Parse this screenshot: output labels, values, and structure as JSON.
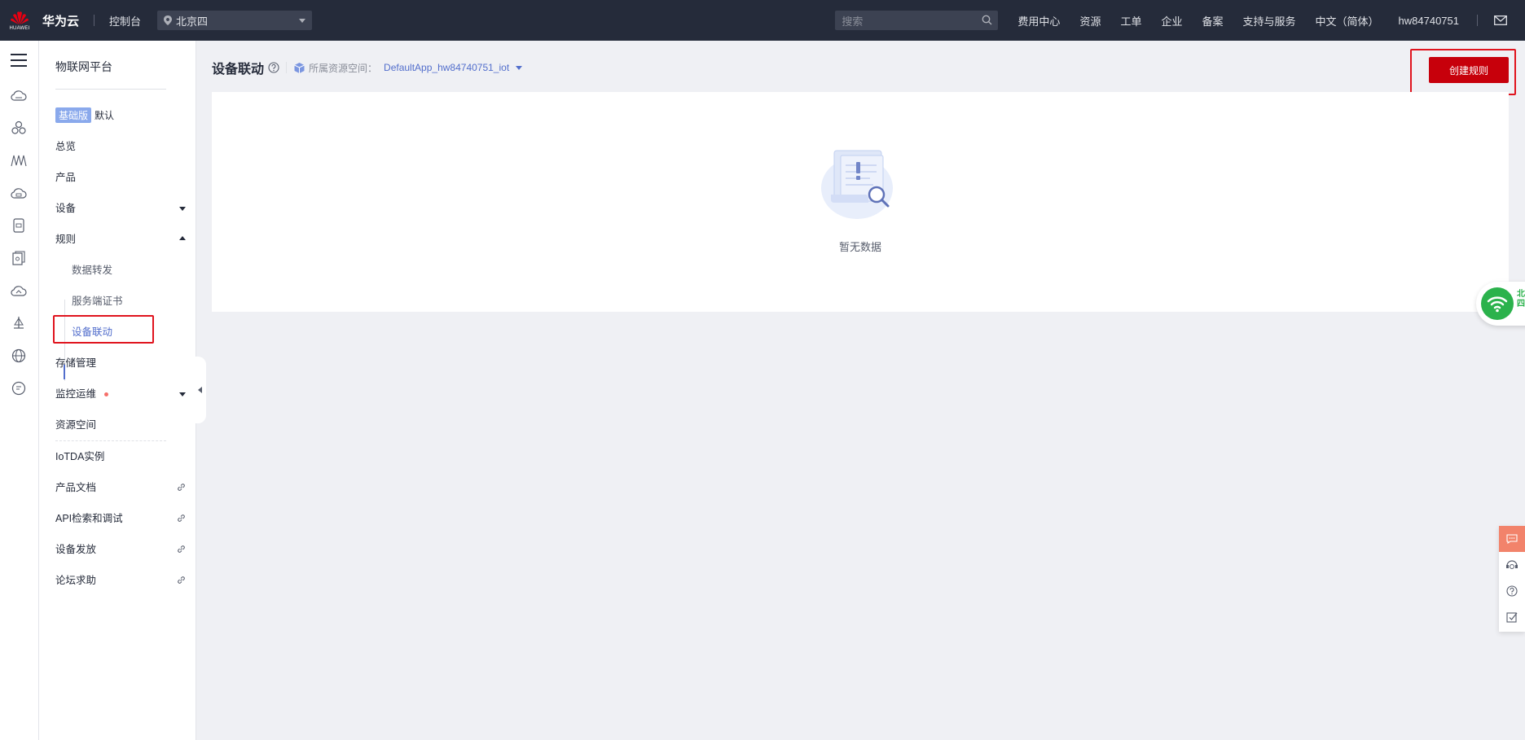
{
  "topbar": {
    "logo_text": "HUAWEI",
    "brand": "华为云",
    "console": "控制台",
    "region": "北京四",
    "search_placeholder": "搜索",
    "nav": [
      "费用中心",
      "资源",
      "工单",
      "企业",
      "备案",
      "支持与服务",
      "中文（简体）"
    ],
    "username": "hw84740751"
  },
  "rail": {
    "icons": [
      "menu-icon",
      "cloud-icon",
      "cluster-icon",
      "chart-icon",
      "cloud-db-icon",
      "device-icon",
      "doc-icon",
      "cloud-upload-icon",
      "scale-icon",
      "globe-icon",
      "chat-icon"
    ]
  },
  "sidebar": {
    "title": "物联网平台",
    "badge": "基础版",
    "badge_default": "默认",
    "items": {
      "overview": "总览",
      "product": "产品",
      "device": "设备",
      "rules": "规则",
      "data_forwarding": "数据转发",
      "server_cert": "服务端证书",
      "device_linkage": "设备联动",
      "storage": "存储管理",
      "monitoring": "监控运维",
      "resource_space": "资源空间",
      "iotda_instance": "IoTDA实例",
      "product_docs": "产品文档",
      "api_explorer": "API检索和调试",
      "device_provisioning": "设备发放",
      "forum": "论坛求助"
    }
  },
  "main": {
    "title": "设备联动",
    "space_label": "所属资源空间：",
    "space_value": "DefaultApp_hw84740751_iot",
    "create_button": "创建规则",
    "empty_text": "暂无数据"
  },
  "float": {
    "tag_lines": [
      "北",
      "四"
    ]
  },
  "colors": {
    "topbar": "#252b3a",
    "accent": "#526ecc",
    "primary_button": "#c7000b",
    "highlight": "#e0141e"
  }
}
